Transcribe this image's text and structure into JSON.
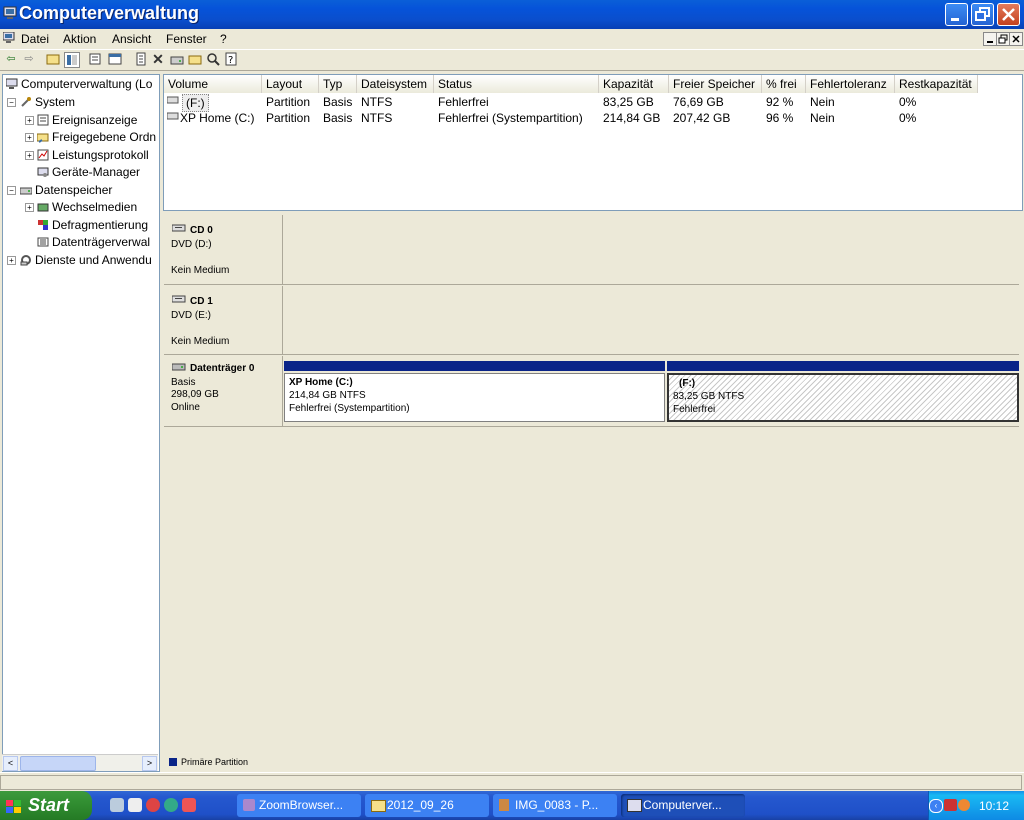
{
  "window": {
    "title": "Computerverwaltung"
  },
  "menu": {
    "items": [
      "Datei",
      "Aktion",
      "Ansicht",
      "Fenster",
      "?"
    ]
  },
  "tree": {
    "root": "Computerverwaltung (Lo",
    "system": "System",
    "ereignis": "Ereignisanzeige",
    "freigabe": "Freigegebene Ordn",
    "leistung": "Leistungsprotokoll",
    "geraete": "Geräte-Manager",
    "datenspeicher": "Datenspeicher",
    "wechsel": "Wechselmedien",
    "defrag": "Defragmentierung",
    "datentraeger": "Datenträgerverwal",
    "dienste": "Dienste und Anwendu"
  },
  "table": {
    "headers": [
      "Volume",
      "Layout",
      "Typ",
      "Dateisystem",
      "Status",
      "Kapazität",
      "Freier Speicher",
      "% frei",
      "Fehlertoleranz",
      "Restkapazität"
    ],
    "rows": [
      [
        "(F:)",
        "Partition",
        "Basis",
        "NTFS",
        "Fehlerfrei",
        "83,25 GB",
        "76,69 GB",
        "92 %",
        "Nein",
        "0%"
      ],
      [
        "XP Home (C:)",
        "Partition",
        "Basis",
        "NTFS",
        "Fehlerfrei (Systempartition)",
        "214,84 GB",
        "207,42 GB",
        "96 %",
        "Nein",
        "0%"
      ]
    ]
  },
  "disks": {
    "cd0": {
      "name": "CD 0",
      "type": "DVD (D:)",
      "status": "Kein Medium"
    },
    "cd1": {
      "name": "CD 1",
      "type": "DVD (E:)",
      "status": "Kein Medium"
    },
    "disk0": {
      "name": "Datenträger 0",
      "kind": "Basis",
      "size": "298,09 GB",
      "state": "Online",
      "partitions": [
        {
          "name": "XP Home  (C:)",
          "size": "214,84 GB NTFS",
          "status": "Fehlerfrei (Systempartition)"
        },
        {
          "name": "(F:)",
          "size": "83,25 GB NTFS",
          "status": "Fehlerfrei"
        }
      ]
    }
  },
  "legend": {
    "label": "Primäre Partition",
    "color": "#0A2488"
  },
  "taskbar": {
    "start": "Start",
    "tasks": [
      "ZoomBrowser...",
      "2012_09_26",
      "IMG_0083 - P...",
      "Computerver..."
    ],
    "clock": "10:12"
  }
}
